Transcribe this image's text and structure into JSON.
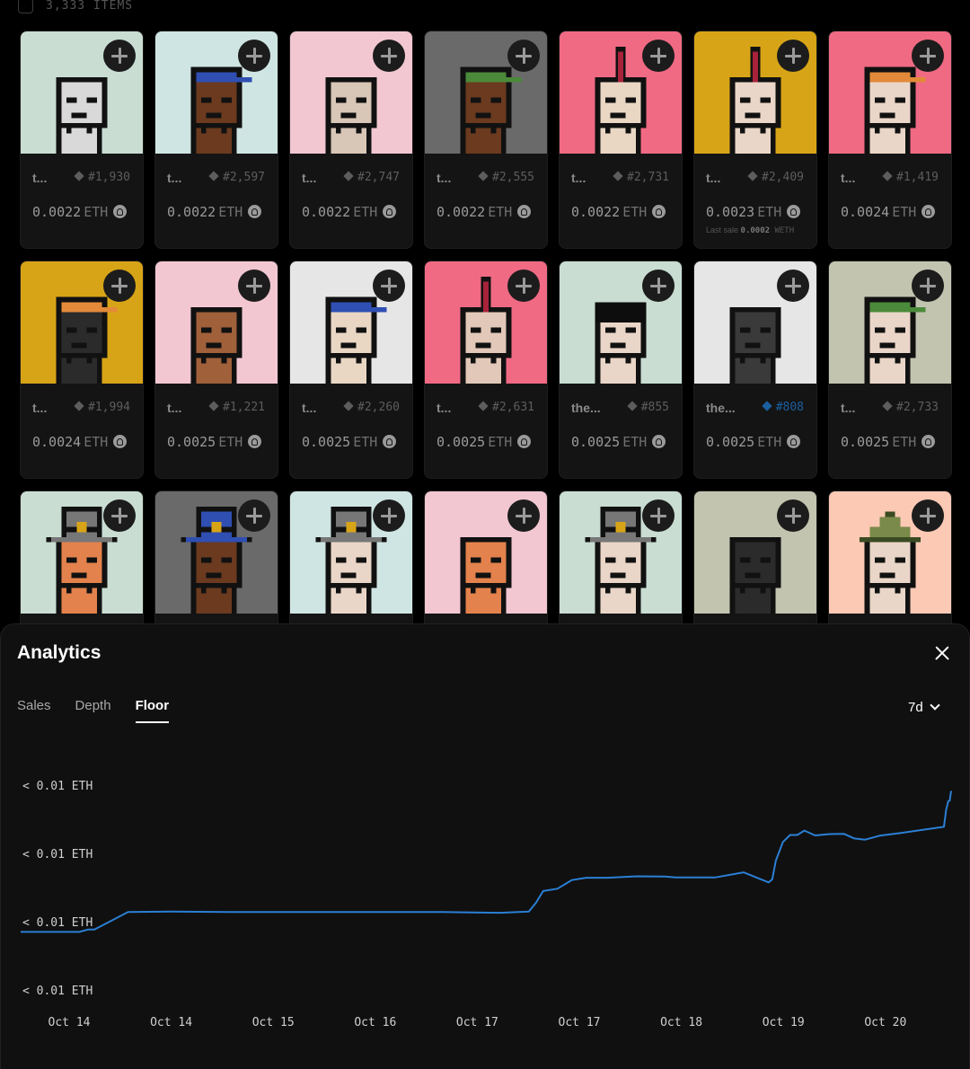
{
  "collection": {
    "items_count": "3,333 ITEMS"
  },
  "grid": {
    "rows": [
      [
        {
          "name": "t...",
          "token": "#1,930",
          "price": "0.0022",
          "unit": "ETH",
          "bg": "#c9ddd3",
          "head": "#d9d9d9",
          "hat": "none"
        },
        {
          "name": "t...",
          "token": "#2,597",
          "price": "0.0022",
          "unit": "ETH",
          "bg": "#cfe5e3",
          "head": "#6b3a1f",
          "hat": "cap-blue"
        },
        {
          "name": "t...",
          "token": "#2,747",
          "price": "0.0022",
          "unit": "ETH",
          "bg": "#f2c7d2",
          "head": "#d8c6b6",
          "hat": "none"
        },
        {
          "name": "t...",
          "token": "#2,555",
          "price": "0.0022",
          "unit": "ETH",
          "bg": "#6a6a6a",
          "head": "#6b3a1f",
          "hat": "cap-green"
        },
        {
          "name": "t...",
          "token": "#2,731",
          "price": "0.0022",
          "unit": "ETH",
          "bg": "#f06a84",
          "head": "#e9d7c4",
          "hat": "mohawk"
        },
        {
          "name": "t...",
          "token": "#2,409",
          "price": "0.0023",
          "unit": "ETH",
          "bg": "#d8a417",
          "head": "#ead6c8",
          "hat": "mohawk",
          "last_sale_label": "Last sale",
          "last_sale_value": "0.0002",
          "last_sale_unit": "WETH"
        },
        {
          "name": "t...",
          "token": "#1,419",
          "price": "0.0024",
          "unit": "ETH",
          "bg": "#f06a84",
          "head": "#ead6c8",
          "hat": "cap-orange"
        }
      ],
      [
        {
          "name": "t...",
          "token": "#1,994",
          "price": "0.0024",
          "unit": "ETH",
          "bg": "#d8a417",
          "head": "#2b2b2b",
          "hat": "cap-orange"
        },
        {
          "name": "t...",
          "token": "#1,221",
          "price": "0.0025",
          "unit": "ETH",
          "bg": "#f2c7d2",
          "head": "#a0603a",
          "hat": "none"
        },
        {
          "name": "t...",
          "token": "#2,260",
          "price": "0.0025",
          "unit": "ETH",
          "bg": "#e6e6e6",
          "head": "#e9d7c4",
          "hat": "cap-blue"
        },
        {
          "name": "t...",
          "token": "#2,631",
          "price": "0.0025",
          "unit": "ETH",
          "bg": "#f06a84",
          "head": "#e2c8b8",
          "hat": "mohawk"
        },
        {
          "name": "the...",
          "token": "#855",
          "price": "0.0025",
          "unit": "ETH",
          "bg": "#c9ddd3",
          "head": "#ead6c8",
          "hat": "hair-black"
        },
        {
          "name": "the...",
          "token": "#808",
          "price": "0.0025",
          "unit": "ETH",
          "bg": "#e6e6e6",
          "head": "#3a3a3a",
          "hat": "none",
          "highlight": true
        },
        {
          "name": "t...",
          "token": "#2,733",
          "price": "0.0025",
          "unit": "ETH",
          "bg": "#c3c4b0",
          "head": "#ead6c8",
          "hat": "cap-green"
        }
      ],
      [
        {
          "bg": "#c9ddd3",
          "head": "#e3824c",
          "hat": "tophat"
        },
        {
          "bg": "#6a6a6a",
          "head": "#6b3a1f",
          "hat": "tophat-blue"
        },
        {
          "bg": "#cfe5e3",
          "head": "#ead6c8",
          "hat": "tophat"
        },
        {
          "bg": "#f2c7d2",
          "head": "#e3824c",
          "hat": "none"
        },
        {
          "bg": "#c9ddd3",
          "head": "#ead6c8",
          "hat": "tophat"
        },
        {
          "bg": "#c3c4b0",
          "head": "#2b2b2b",
          "hat": "none"
        },
        {
          "bg": "#fbc9b4",
          "head": "#ead6c8",
          "hat": "conical"
        }
      ]
    ]
  },
  "analytics": {
    "title": "Analytics",
    "tabs": [
      {
        "label": "Sales",
        "active": false
      },
      {
        "label": "Depth",
        "active": false
      },
      {
        "label": "Floor",
        "active": true
      }
    ],
    "range": "7d"
  },
  "chart_data": {
    "type": "line",
    "title": "",
    "series": [
      {
        "color": "#2b7fd4",
        "x": [
          0,
          0.27,
          0.57,
          0.82,
          0.94,
          1.03,
          1.5,
          2.1,
          3.0,
          4.0,
          5.1,
          5.9,
          6.7,
          7.1,
          7.2,
          7.3,
          7.5,
          7.7,
          7.9,
          8.2,
          8.6,
          9.0,
          9.15,
          9.4,
          9.7,
          10.1,
          10.45,
          10.5,
          10.55,
          10.65,
          10.75,
          10.85,
          10.95,
          11.1,
          11.3,
          11.5,
          11.65,
          11.8,
          12.0,
          12.3,
          12.9,
          12.93,
          12.96,
          12.98,
          13.0
        ],
        "y": [
          0.0026,
          0.0026,
          0.0026,
          0.0026,
          0.0027,
          0.0027,
          0.00345,
          0.00347,
          0.00345,
          0.00345,
          0.00345,
          0.00345,
          0.00342,
          0.00347,
          0.00385,
          0.00435,
          0.00445,
          0.00482,
          0.00492,
          0.00492,
          0.00498,
          0.00497,
          0.00493,
          0.00493,
          0.00493,
          0.00515,
          0.00472,
          0.00485,
          0.00565,
          0.00645,
          0.00675,
          0.00675,
          0.00694,
          0.00673,
          0.00679,
          0.0068,
          0.0066,
          0.00655,
          0.00672,
          0.00684,
          0.0071,
          0.00782,
          0.0082,
          0.00822,
          0.00864
        ]
      }
    ],
    "ylabels": [
      "< 0.01 ETH",
      "< 0.01 ETH",
      "< 0.01 ETH",
      "< 0.01 ETH"
    ],
    "xlabels": [
      "Oct 14",
      "Oct 14",
      "Oct 15",
      "Oct 16",
      "Oct 17",
      "Oct 17",
      "Oct 18",
      "Oct 19",
      "Oct 20"
    ],
    "ylim": [
      0.0,
      0.01
    ],
    "grid": false
  }
}
